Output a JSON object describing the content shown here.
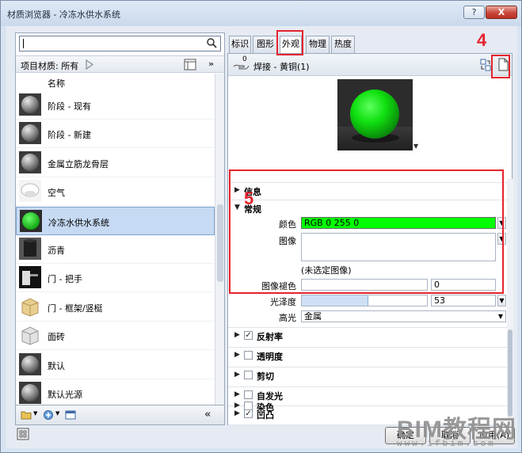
{
  "window": {
    "title": "材质浏览器 - 冷冻水供水系统",
    "help_label": "?",
    "close_label": "X"
  },
  "search": {
    "value": "",
    "placeholder": ""
  },
  "filter": {
    "label": "项目材质: 所有"
  },
  "list": {
    "header": "名称",
    "items": [
      {
        "label": "阶段 - 现有",
        "thumb": "sphere-gray"
      },
      {
        "label": "阶段 - 新建",
        "thumb": "sphere-gray"
      },
      {
        "label": "金属立筋龙骨层",
        "thumb": "sphere-gray"
      },
      {
        "label": "空气",
        "thumb": "sphere-cloud"
      },
      {
        "label": "冷冻水供水系统",
        "thumb": "sphere-green",
        "selected": true
      },
      {
        "label": "沥青",
        "thumb": "cylinder-dark"
      },
      {
        "label": "门 - 把手",
        "thumb": "handle"
      },
      {
        "label": "门 - 框架/竖梃",
        "thumb": "cube-wood"
      },
      {
        "label": "面砖",
        "thumb": "cube-tile"
      },
      {
        "label": "默认",
        "thumb": "sphere-gray"
      },
      {
        "label": "默认光源",
        "thumb": "sphere-gray"
      }
    ]
  },
  "tabs": [
    {
      "label": "标识",
      "active": false
    },
    {
      "label": "图形",
      "active": false
    },
    {
      "label": "外观",
      "active": true
    },
    {
      "label": "物理",
      "active": false
    },
    {
      "label": "热度",
      "active": false
    }
  ],
  "asset": {
    "users": "0",
    "name": "焊接 - 黄铜(1)"
  },
  "sections": {
    "info": "信息",
    "general": "常规",
    "reflectivity": "反射率",
    "transparency": "透明度",
    "cutout": "剪切",
    "self_illum": "自发光",
    "bump": "凹凸",
    "tint": "染色"
  },
  "properties": {
    "color_label": "颜色",
    "color_value": "RGB 0 255 0",
    "image_label": "图像",
    "no_image": "(未选定图像)",
    "image_fade_label": "图像褪色",
    "image_fade_value": "0",
    "glossiness_label": "光泽度",
    "glossiness_value": "53",
    "highlight_label": "高光",
    "highlight_value": "金属"
  },
  "annotations": {
    "four": "4",
    "five": "5"
  },
  "buttons": {
    "ok": "确定",
    "cancel": "取消",
    "apply": "应用(A)"
  },
  "watermark": {
    "text": "BIM教程网",
    "url": "www.ifbim.com"
  },
  "colors": {
    "accent_red": "#e5232d",
    "swatch_green": "#00ff00",
    "selection": "#c7daf3"
  }
}
